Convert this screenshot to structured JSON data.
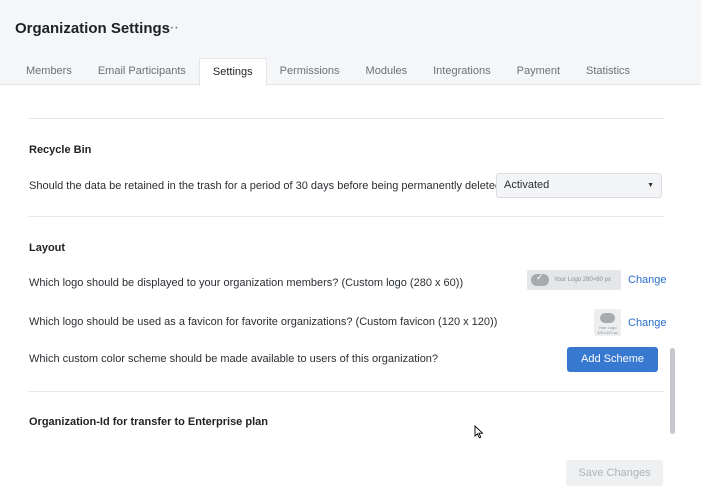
{
  "header": {
    "title": "Organization Settings",
    "more_icon": "⋯"
  },
  "tabs": [
    {
      "label": "Members"
    },
    {
      "label": "Email Participants"
    },
    {
      "label": "Settings",
      "active": true
    },
    {
      "label": "Permissions"
    },
    {
      "label": "Modules"
    },
    {
      "label": "Integrations"
    },
    {
      "label": "Payment"
    },
    {
      "label": "Statistics"
    }
  ],
  "recycle_bin": {
    "title": "Recycle Bin",
    "question": "Should the data be retained in the trash for a period of 30 days before being permanently deleted?",
    "select_value": "Activated"
  },
  "layout": {
    "title": "Layout",
    "logo_question": "Which logo should be displayed to your organization members? (Custom logo (280 x 60))",
    "logo_preview_text": "Your Logo 280×60 px",
    "logo_change": "Change",
    "favicon_question": "Which logo should be used as a favicon for favorite organizations? (Custom favicon (120 x 120))",
    "favicon_preview_text": "Your Logo 120×120 px",
    "favicon_change": "Change",
    "scheme_question": "Which custom color scheme should be made available to users of this organization?",
    "add_scheme_label": "Add Scheme"
  },
  "enterprise": {
    "title": "Organization-Id for transfer to Enterprise plan"
  },
  "footer": {
    "save_label": "Save Changes"
  },
  "colors": {
    "accent": "#3778d1",
    "link": "#2a6fc9",
    "header_bg": "#f5f6f7"
  },
  "icons": {
    "more": "more-horizontal-icon",
    "select_caret": "caret-down-icon",
    "logo": "cloud-check-icon",
    "cursor": "mouse-pointer-icon"
  }
}
